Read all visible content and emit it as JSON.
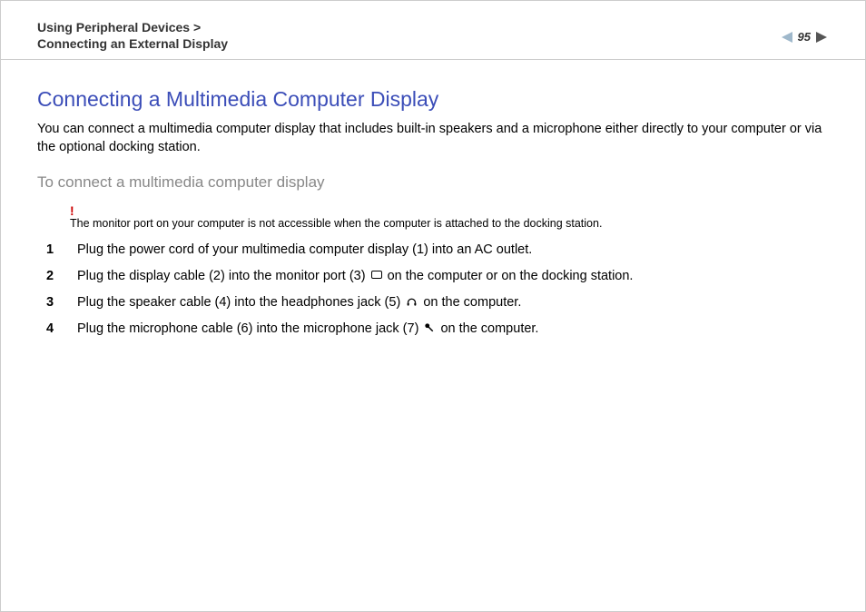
{
  "header": {
    "breadcrumb_line1": "Using Peripheral Devices >",
    "breadcrumb_line2": "Connecting an External Display",
    "page_number": "95"
  },
  "content": {
    "title": "Connecting a Multimedia Computer Display",
    "intro": "You can connect a multimedia computer display that includes built-in speakers and a microphone either directly to your computer or via the optional docking station.",
    "subheading": "To connect a multimedia computer display",
    "warning_mark": "!",
    "warning_text": "The monitor port on your computer is not accessible when the computer is attached to the docking station.",
    "steps": [
      {
        "num": "1",
        "before": "Plug the power cord of your multimedia computer display (1) into an AC outlet.",
        "icon": null,
        "after": ""
      },
      {
        "num": "2",
        "before": "Plug the display cable (2) into the monitor port (3) ",
        "icon": "monitor",
        "after": " on the computer or on the docking station."
      },
      {
        "num": "3",
        "before": "Plug the speaker cable (4) into the headphones jack (5) ",
        "icon": "headphone",
        "after": " on the computer."
      },
      {
        "num": "4",
        "before": "Plug the microphone cable (6) into the microphone jack (7) ",
        "icon": "mic",
        "after": " on the computer."
      }
    ]
  }
}
